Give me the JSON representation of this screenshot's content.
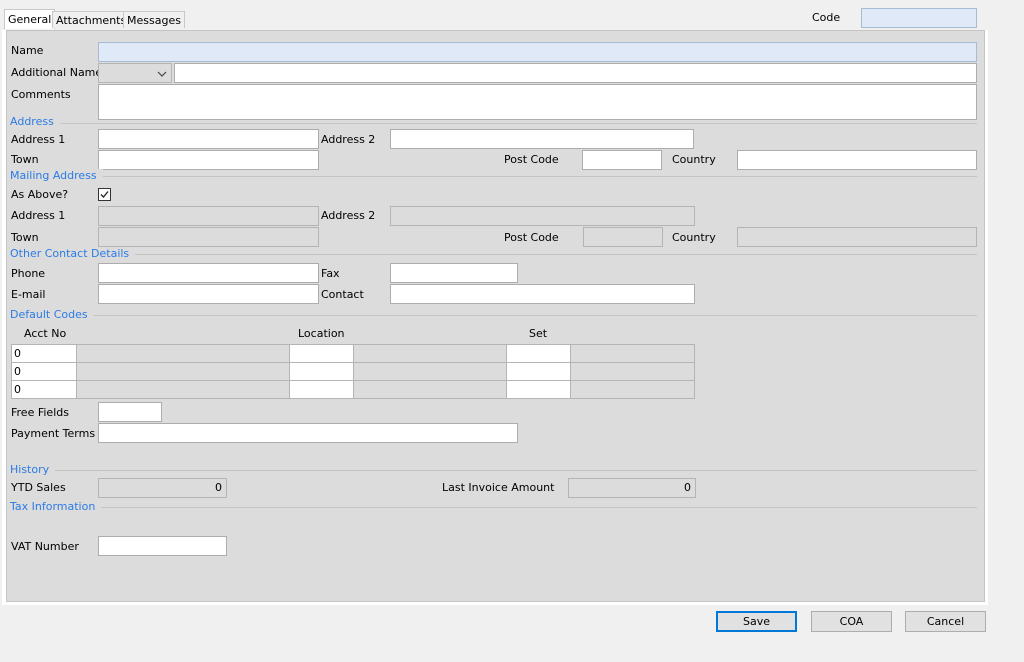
{
  "tabs": [
    "General",
    "Attachments",
    "Messages"
  ],
  "code_label": "Code",
  "fields": {
    "name": "Name",
    "additional_name": "Additional Name",
    "comments": "Comments",
    "address1": "Address 1",
    "address2": "Address 2",
    "town": "Town",
    "post_code": "Post Code",
    "country": "Country",
    "as_above": "As Above?",
    "phone": "Phone",
    "fax": "Fax",
    "email": "E-mail",
    "contact": "Contact",
    "free_fields": "Free Fields",
    "payment_terms": "Payment Terms",
    "ytd_sales": "YTD Sales",
    "last_invoice_amount": "Last Invoice Amount",
    "vat_number": "VAT Number"
  },
  "sections": {
    "address": "Address",
    "mailing_address": "Mailing Address",
    "other_contact": "Other Contact Details",
    "default_codes": "Default Codes",
    "history": "History",
    "tax_information": "Tax Information"
  },
  "default_codes": {
    "columns": [
      "Acct No",
      "Location",
      "Set"
    ],
    "rows": [
      {
        "acct_no": "0"
      },
      {
        "acct_no": "0"
      },
      {
        "acct_no": "0"
      }
    ]
  },
  "values": {
    "ytd_sales": "0",
    "last_invoice_amount": "0",
    "as_above_checked": true
  },
  "buttons": {
    "save": "Save",
    "coa": "COA",
    "cancel": "Cancel"
  },
  "icons": {
    "dropdown": "chevron-down-icon",
    "checkbox": "checkmark-icon"
  }
}
